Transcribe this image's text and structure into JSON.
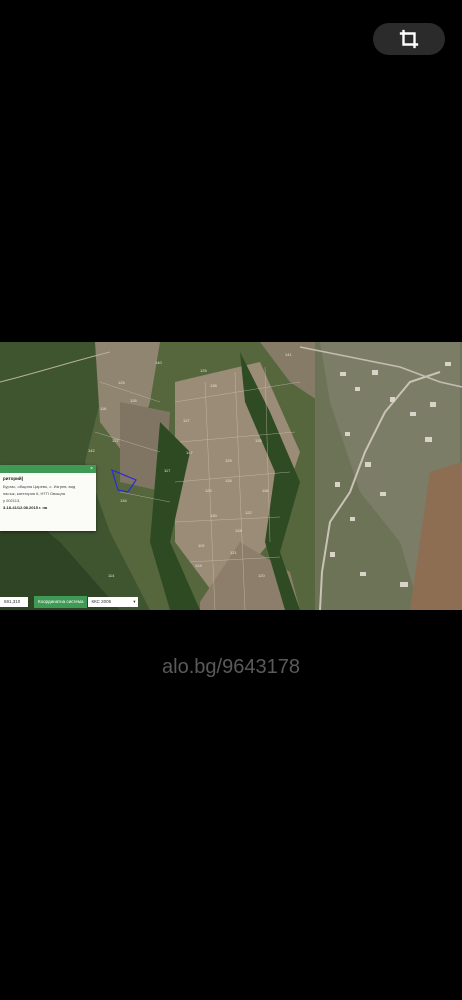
{
  "viewer": {
    "crop_icon": "crop-icon",
    "watermark": "alo.bg/9643178"
  },
  "map": {
    "popup": {
      "title": "риторий)",
      "close": "×",
      "lines": [
        "Бургас, община Царево, с. Изгрев, вид",
        "пасъж, категория 6, НТП Овощна",
        "у 002113,",
        "3-18-41/12.08.2015 г. на"
      ]
    },
    "coordinates": {
      "value": "691,310",
      "label": "Координатна система",
      "system": "ККС 2005",
      "dropdown_icon": "chevron-down-icon"
    },
    "parcel_labels": [
      "140",
      "125",
      "126",
      "125",
      "127",
      "138",
      "141",
      "135",
      "116",
      "127",
      "129",
      "117",
      "123",
      "118",
      "147",
      "126",
      "134",
      "130",
      "122",
      "128",
      "119",
      "121",
      "124",
      "120",
      "142",
      "114"
    ],
    "colors": {
      "accent": "#3f9a55",
      "parcel_outline": "#2b2bd6"
    }
  }
}
